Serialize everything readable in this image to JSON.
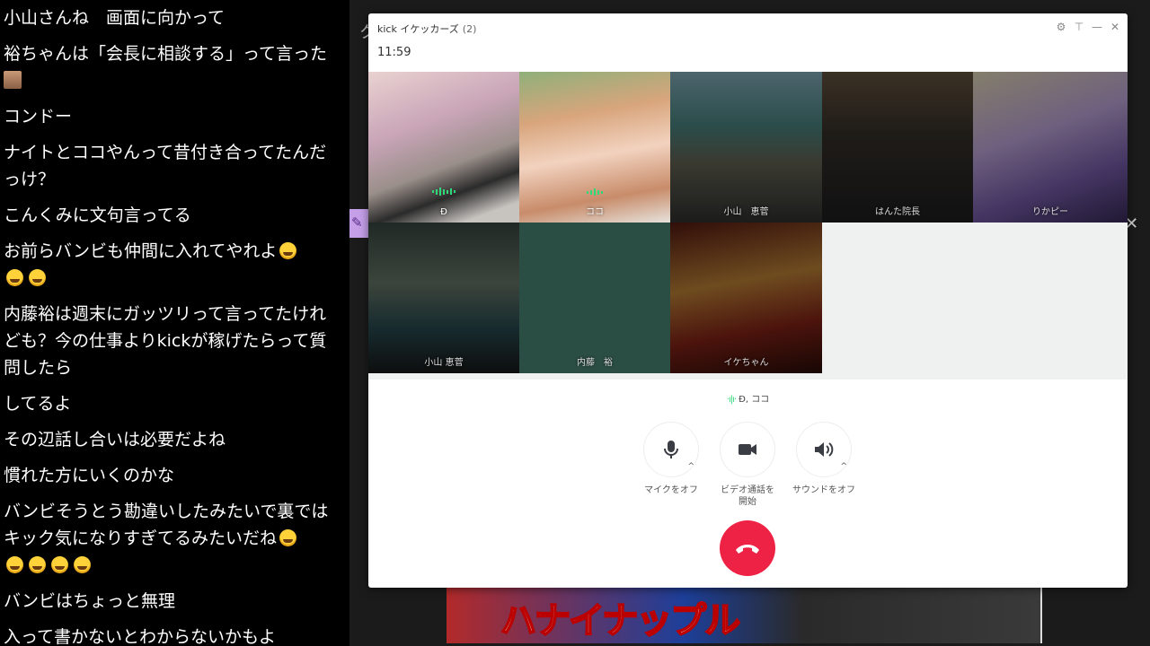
{
  "chat": {
    "messages": [
      {
        "text": "小山さんね　画面に向かって",
        "emoji_after": 0
      },
      {
        "text": "裕ちゃんは「会長に相談する」って言った",
        "emoji_after": 0
      },
      {
        "text": "コンドー",
        "emoji_after": 0
      },
      {
        "text": "ナイトとココやんって昔付き合ってたんだっけ？",
        "emoji_after": 0
      },
      {
        "text": "こんくみに文句言ってる",
        "emoji_after": 0
      },
      {
        "text": "お前らバンビも仲間に入れてやれよ",
        "emoji_after": 3
      },
      {
        "text": "内藤裕は週末にガッツリって言ってたけれども？今の仕事よりkickが稼げたらって質問したら",
        "emoji_after": 0
      },
      {
        "text": "してるよ",
        "emoji_after": 0
      },
      {
        "text": "その辺話し合いは必要だよね",
        "emoji_after": 0
      },
      {
        "text": "慣れた方にいくのかな",
        "emoji_after": 0
      },
      {
        "text": "バンビそうとう勘違いしたみたいで裏ではキック気になりすぎてるみたいだね",
        "emoji_after": 5
      },
      {
        "text": "バンビはちょっと無理",
        "emoji_after": 0
      },
      {
        "text": "入って書かないとわからないかもよ",
        "emoji_after": 0
      }
    ]
  },
  "stream": {
    "banner_text": "ハナイナップル"
  },
  "call": {
    "title": "kick イケッカーズ",
    "member_count": "(2)",
    "elapsed": "11:59",
    "speaking_label": "Ð, ココ",
    "participants": [
      {
        "name": "Ð",
        "speaking": true
      },
      {
        "name": "ココ",
        "speaking": true
      },
      {
        "name": "小山　恵菅",
        "speaking": false
      },
      {
        "name": "はんた院長",
        "speaking": false
      },
      {
        "name": "りかピー",
        "speaking": false
      },
      {
        "name": "小山 恵菅",
        "speaking": false
      },
      {
        "name": "内藤　裕",
        "speaking": false
      },
      {
        "name": "イケちゃん",
        "speaking": false
      }
    ],
    "controls": {
      "mic_label": "マイクをオフ",
      "video_label_1": "ビデオ通話を",
      "video_label_2": "開始",
      "sound_label": "サウンドをオフ"
    },
    "icons": {
      "settings": "gear-icon",
      "pin": "pin-icon",
      "minimize": "minimize-icon",
      "close": "close-icon",
      "mic": "microphone-icon",
      "video": "video-camera-icon",
      "sound": "speaker-icon",
      "hangup": "phone-hangup-icon"
    },
    "colors": {
      "hangup": "#ee2244",
      "speaking": "#2fd97a"
    }
  }
}
